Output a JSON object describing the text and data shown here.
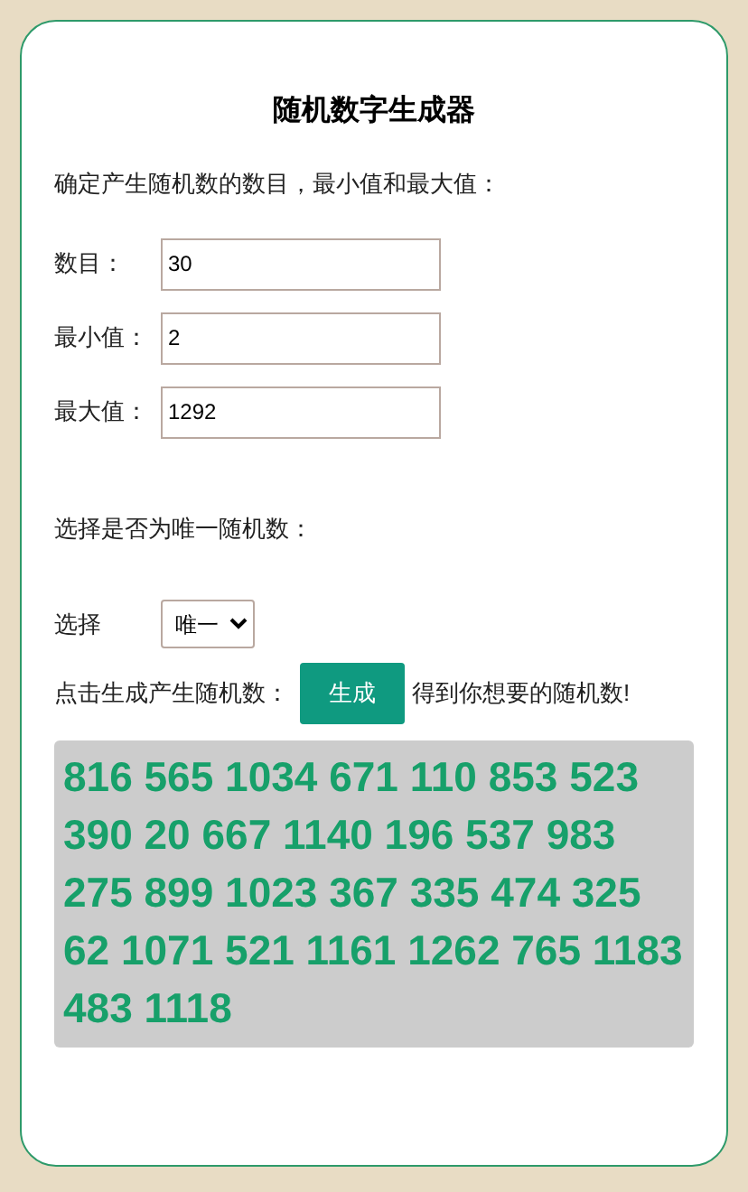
{
  "title": "随机数字生成器",
  "intro": "确定产生随机数的数目，最小值和最大值：",
  "fields": [
    {
      "label": "数目：",
      "value": "30"
    },
    {
      "label": "最小值：",
      "value": "2"
    },
    {
      "label": "最大值：",
      "value": "1292"
    }
  ],
  "unique_prompt": "选择是否为唯一随机数：",
  "select": {
    "label": "选择",
    "value": "唯一"
  },
  "generate": {
    "prompt": "点击生成产生随机数：",
    "button": "生成",
    "suffix": "得到你想要的随机数!"
  },
  "result": "816 565 1034 671 110 853 523 390 20 667 1140 196 537 983 275 899 1023 367 335 474 325 62 1071 521 1161 1262 765 1183 483 1118"
}
